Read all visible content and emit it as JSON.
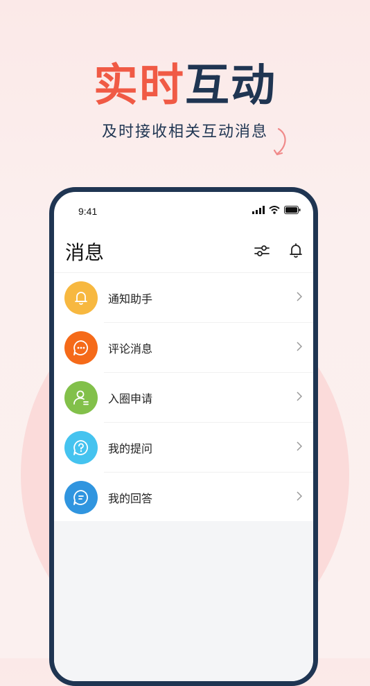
{
  "banner": {
    "headline_accent": "实时",
    "headline_main": "互动",
    "subline": "及时接收相关互动消息"
  },
  "colors": {
    "accent": "#f05a45",
    "navy": "#1f3552",
    "background": "#fbeeed"
  },
  "status_bar": {
    "time": "9:41"
  },
  "header": {
    "title": "消息",
    "filter_icon": "filter-sliders-icon",
    "bell_icon": "bell-icon"
  },
  "messages": [
    {
      "label": "通知助手",
      "icon": "bell-icon",
      "color": "#f7b840"
    },
    {
      "label": "评论消息",
      "icon": "chat-bubble-dots-icon",
      "color": "#f56a19"
    },
    {
      "label": "入圈申请",
      "icon": "user-add-icon",
      "color": "#82c04a"
    },
    {
      "label": "我的提问",
      "icon": "question-bubble-icon",
      "color": "#45c3ef"
    },
    {
      "label": "我的回答",
      "icon": "answer-bubble-icon",
      "color": "#3095df"
    }
  ]
}
